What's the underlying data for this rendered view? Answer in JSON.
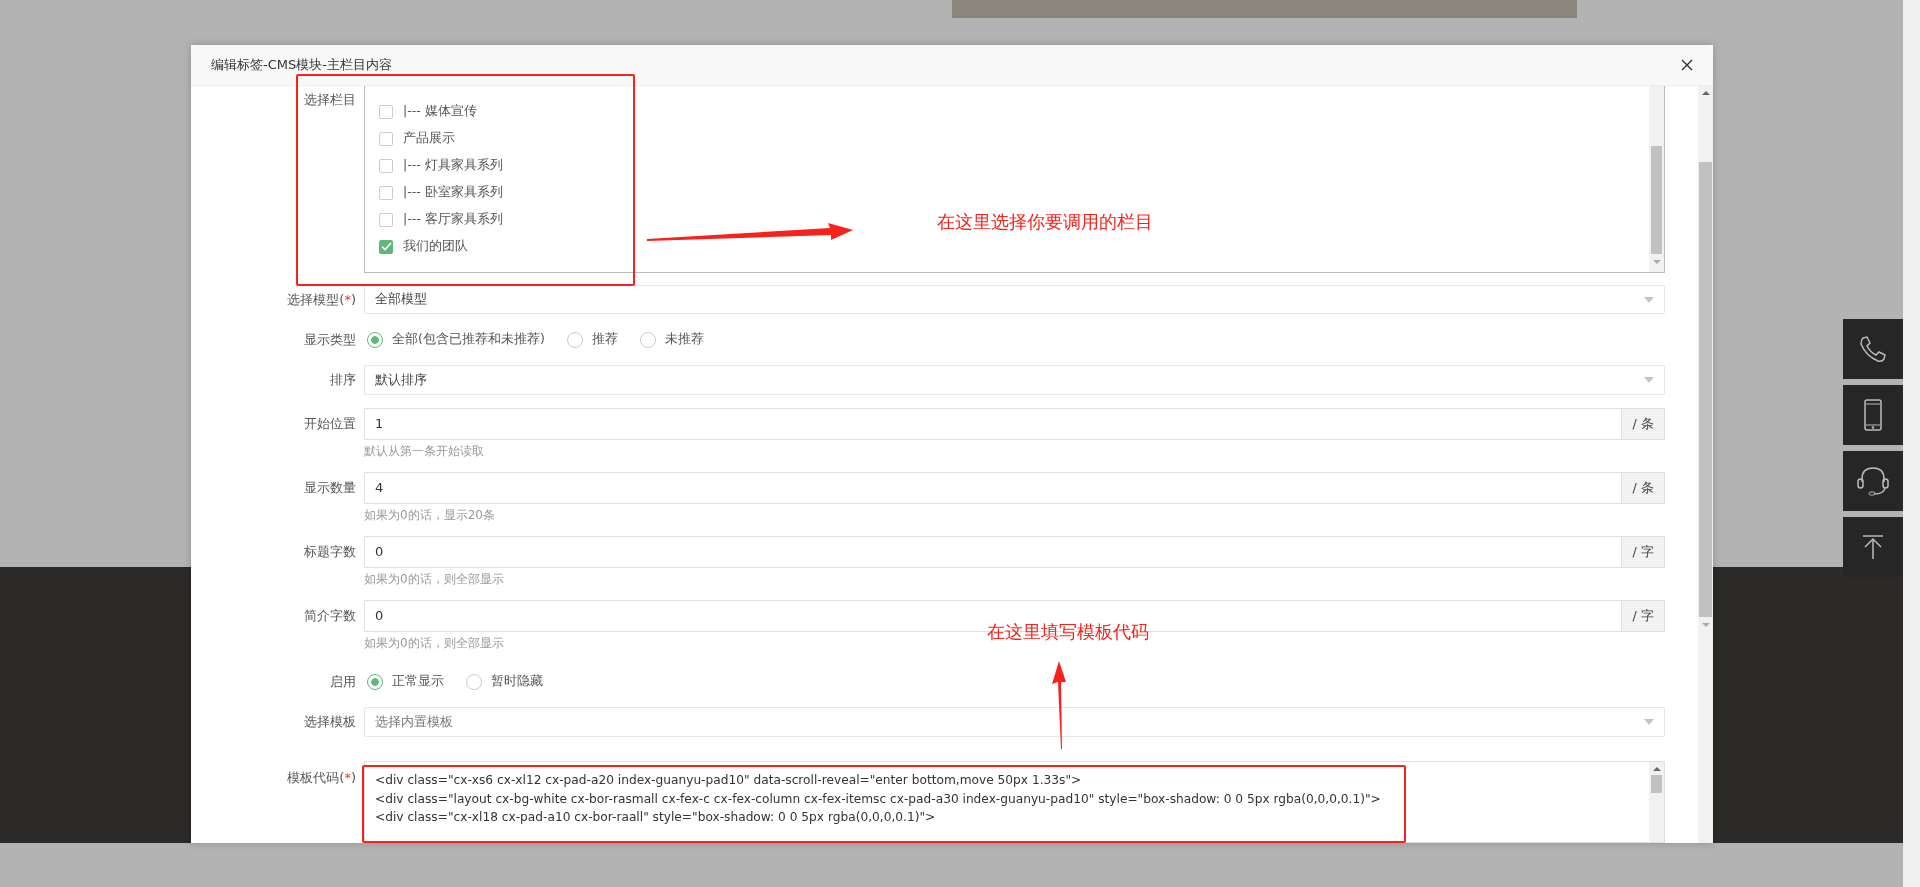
{
  "dialog": {
    "title": "编辑标签-CMS模块-主栏目内容"
  },
  "fields": [
    {
      "kind": "checklist",
      "label": "选择栏目",
      "options": [
        {
          "label": "|--- 媒体宣传",
          "checked": false
        },
        {
          "label": "产品展示",
          "checked": false
        },
        {
          "label": "|--- 灯具家具系列",
          "checked": false
        },
        {
          "label": "|--- 卧室家具系列",
          "checked": false
        },
        {
          "label": "|--- 客厅家具系列",
          "checked": false
        },
        {
          "label": "我们的团队",
          "checked": true
        }
      ]
    },
    {
      "kind": "select",
      "label": "选择模型",
      "marker": "(*)",
      "value": "全部模型"
    },
    {
      "kind": "radio",
      "label": "显示类型",
      "options": [
        {
          "label": "全部(包含已推荐和未推荐)",
          "selected": true
        },
        {
          "label": "推荐",
          "selected": false
        },
        {
          "label": "未推荐",
          "selected": false
        }
      ]
    },
    {
      "kind": "select",
      "label": "排序",
      "value": "默认排序"
    },
    {
      "kind": "number",
      "label": "开始位置",
      "value": "1",
      "unit": "/ 条",
      "hint": "默认从第一条开始读取"
    },
    {
      "kind": "number",
      "label": "显示数量",
      "value": "4",
      "unit": "/ 条",
      "hint": "如果为0的话，显示20条"
    },
    {
      "kind": "number",
      "label": "标题字数",
      "value": "0",
      "unit": "/ 字",
      "hint": "如果为0的话，则全部显示"
    },
    {
      "kind": "number",
      "label": "简介字数",
      "value": "0",
      "unit": "/ 字",
      "hint": "如果为0的话，则全部显示"
    },
    {
      "kind": "radio",
      "label": "启用",
      "options": [
        {
          "label": "正常显示",
          "selected": true
        },
        {
          "label": "暂时隐藏",
          "selected": false
        }
      ]
    },
    {
      "kind": "select",
      "label": "选择模板",
      "placeholder": "选择内置模板"
    },
    {
      "kind": "code",
      "label": "模板代码",
      "marker": "(*)",
      "lines": [
        "<div class=\"cx-xs6 cx-xl12 cx-pad-a20 index-guanyu-pad10\" data-scroll-reveal=\"enter bottom,move 50px 1.33s\">",
        "<div class=\"layout cx-bg-white cx-bor-rasmall cx-fex-c cx-fex-column cx-fex-itemsc cx-pad-a30 index-guanyu-pad10\" style=\"box-shadow: 0 0 5px rgba(0,0,0,0.1)\">",
        "<div class=\"cx-xl18 cx-pad-a10 cx-bor-raall\" style=\"box-shadow: 0 0 5px rgba(0,0,0,0.1)\">"
      ]
    }
  ],
  "annotations": [
    {
      "kind": "note",
      "text": "在这里选择你要调用的栏目"
    },
    {
      "kind": "note",
      "text": "在这里填写模板代码"
    }
  ]
}
